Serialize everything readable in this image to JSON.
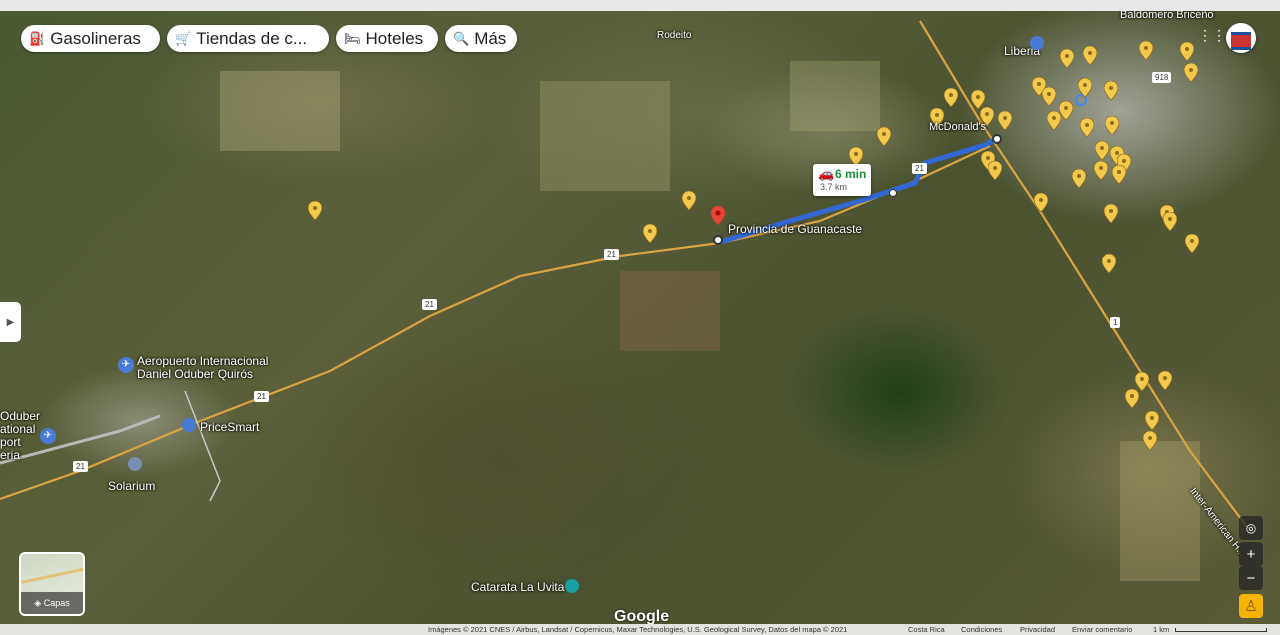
{
  "chips": [
    {
      "label": "Gasolineras",
      "icon": "gas-station-icon"
    },
    {
      "label": "Tiendas de c...",
      "icon": "cart-icon"
    },
    {
      "label": "Hoteles",
      "icon": "bed-icon"
    },
    {
      "label": "Más",
      "icon": "search-icon"
    }
  ],
  "places": {
    "rodeito": "Rodeito",
    "liberia": "Liberia",
    "baldomero": "Baldomero Briceño",
    "mcdonalds": "McDonald's",
    "destination": "Provincia de Guanacaste",
    "airport": "Aeropuerto Internacional\nDaniel Oduber Quirós",
    "airport_cut": "Oduber\national\nport\neria",
    "pricesmart": "PriceSmart",
    "solarium": "Solarium",
    "catarata": "Catarata La Uvita",
    "interamerican": "Inter-American H..."
  },
  "route": {
    "time": "6 min",
    "distance": "3.7 km"
  },
  "road_shields": [
    "21",
    "21",
    "21",
    "21",
    "21",
    "1",
    "918"
  ],
  "layers_label": "Capas",
  "controls": {
    "zoom_in": "+",
    "zoom_out": "−"
  },
  "brand": "Google",
  "attribution": {
    "imagery": "Imágenes © 2021 CNES / Airbus, Landsat / Copernicus, Maxar Technologies, U.S. Geological Survey, Datos del mapa © 2021",
    "country": "Costa Rica",
    "terms": "Condiciones",
    "privacy": "Privacidad",
    "feedback": "Enviar comentario",
    "scale": "1 km"
  },
  "colors": {
    "route": "#3367d6",
    "pin": "#f2c94c",
    "highway": "#d9a441"
  }
}
